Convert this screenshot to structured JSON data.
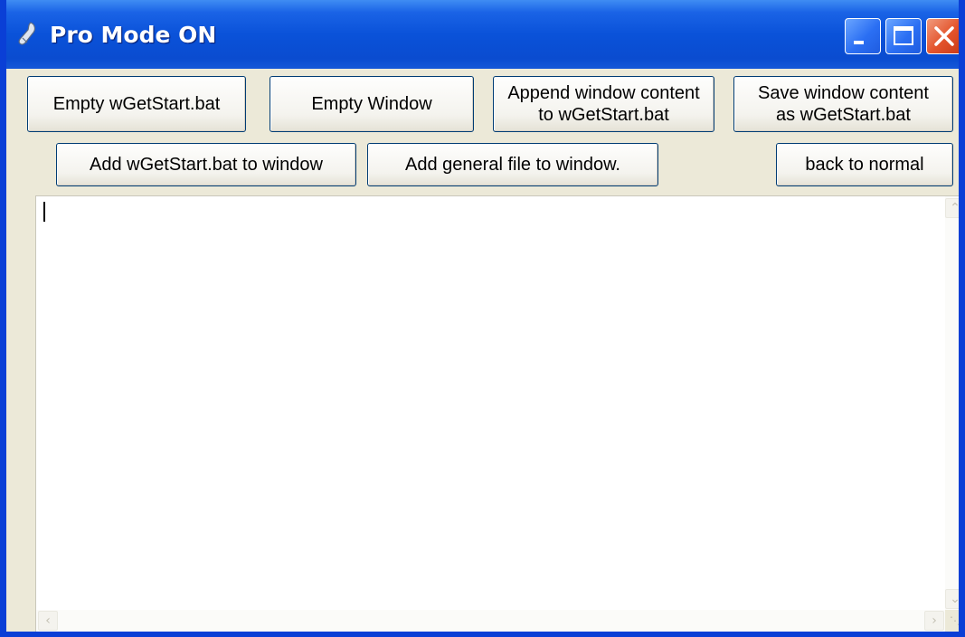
{
  "window": {
    "title": "Pro Mode ON",
    "icon": "app-icon",
    "caption_buttons": {
      "minimize_icon": "minimize-icon",
      "maximize_icon": "maximize-icon",
      "close_icon": "close-icon"
    }
  },
  "buttons": {
    "empty_wgetstart": "Empty wGetStart.bat",
    "empty_window": "Empty Window",
    "append_window_content": "Append window content\nto wGetStart.bat",
    "save_window_content": "Save window content\nas wGetStart.bat",
    "add_wgetstart_to_window": "Add wGetStart.bat to window",
    "add_general_file": "Add general file to window.",
    "back_to_normal": "back to normal"
  },
  "editor": {
    "value": "",
    "scroll_up_icon": "chevron-up-icon",
    "scroll_down_icon": "chevron-down-icon",
    "scroll_left_icon": "chevron-left-icon",
    "scroll_right_icon": "chevron-right-icon"
  },
  "colors": {
    "titlebar": "#0a52d9",
    "window_face": "#ece9d8",
    "close_button": "#e3532b"
  }
}
